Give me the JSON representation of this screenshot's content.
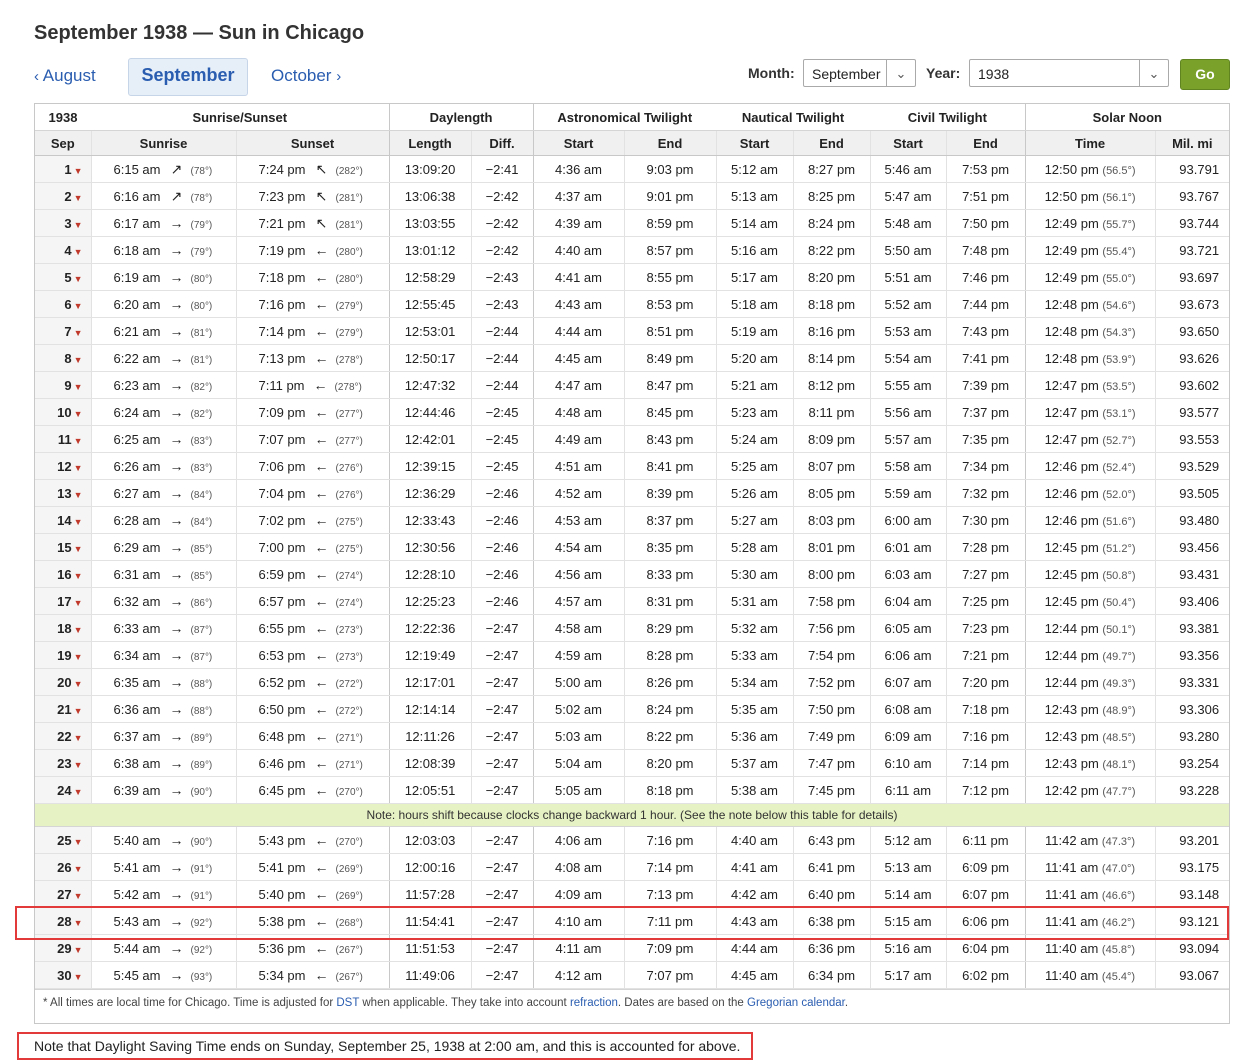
{
  "page": {
    "title": "September 1938 — Sun in Chicago"
  },
  "nav": {
    "prev": "August",
    "current": "September",
    "next": "October"
  },
  "controls": {
    "month_label": "Month:",
    "month_value": "September",
    "year_label": "Year:",
    "year_value": "1938",
    "go_label": "Go"
  },
  "table": {
    "group_headers": {
      "year": "1938",
      "sunrise_sunset": "Sunrise/Sunset",
      "daylength": "Daylength",
      "astro": "Astronomical Twilight",
      "nautical": "Nautical Twilight",
      "civil": "Civil Twilight",
      "noon": "Solar Noon"
    },
    "col_headers": {
      "day": "Sep",
      "sunrise": "Sunrise",
      "sunset": "Sunset",
      "length": "Length",
      "diff": "Diff.",
      "astro_start": "Start",
      "astro_end": "End",
      "naut_start": "Start",
      "naut_end": "End",
      "civil_start": "Start",
      "civil_end": "End",
      "noon_time": "Time",
      "distance": "Mil. mi"
    },
    "rows_before": [
      {
        "day": "1",
        "rise": "6:15 am",
        "rise_arrow": "↗",
        "rise_deg": "(78°)",
        "set": "7:24 pm",
        "set_arrow": "↖",
        "set_deg": "(282°)",
        "len": "13:09:20",
        "diff": "−2:41",
        "as": "4:36 am",
        "ae": "9:03 pm",
        "ns": "5:12 am",
        "ne": "8:27 pm",
        "cs": "5:46 am",
        "ce": "7:53 pm",
        "noon": "12:50 pm",
        "noon_deg": "(56.5°)",
        "mi": "93.791"
      },
      {
        "day": "2",
        "rise": "6:16 am",
        "rise_arrow": "↗",
        "rise_deg": "(78°)",
        "set": "7:23 pm",
        "set_arrow": "↖",
        "set_deg": "(281°)",
        "len": "13:06:38",
        "diff": "−2:42",
        "as": "4:37 am",
        "ae": "9:01 pm",
        "ns": "5:13 am",
        "ne": "8:25 pm",
        "cs": "5:47 am",
        "ce": "7:51 pm",
        "noon": "12:50 pm",
        "noon_deg": "(56.1°)",
        "mi": "93.767"
      },
      {
        "day": "3",
        "rise": "6:17 am",
        "rise_arrow": "→",
        "rise_deg": "(79°)",
        "set": "7:21 pm",
        "set_arrow": "↖",
        "set_deg": "(281°)",
        "len": "13:03:55",
        "diff": "−2:42",
        "as": "4:39 am",
        "ae": "8:59 pm",
        "ns": "5:14 am",
        "ne": "8:24 pm",
        "cs": "5:48 am",
        "ce": "7:50 pm",
        "noon": "12:49 pm",
        "noon_deg": "(55.7°)",
        "mi": "93.744"
      },
      {
        "day": "4",
        "rise": "6:18 am",
        "rise_arrow": "→",
        "rise_deg": "(79°)",
        "set": "7:19 pm",
        "set_arrow": "←",
        "set_deg": "(280°)",
        "len": "13:01:12",
        "diff": "−2:42",
        "as": "4:40 am",
        "ae": "8:57 pm",
        "ns": "5:16 am",
        "ne": "8:22 pm",
        "cs": "5:50 am",
        "ce": "7:48 pm",
        "noon": "12:49 pm",
        "noon_deg": "(55.4°)",
        "mi": "93.721"
      },
      {
        "day": "5",
        "rise": "6:19 am",
        "rise_arrow": "→",
        "rise_deg": "(80°)",
        "set": "7:18 pm",
        "set_arrow": "←",
        "set_deg": "(280°)",
        "len": "12:58:29",
        "diff": "−2:43",
        "as": "4:41 am",
        "ae": "8:55 pm",
        "ns": "5:17 am",
        "ne": "8:20 pm",
        "cs": "5:51 am",
        "ce": "7:46 pm",
        "noon": "12:49 pm",
        "noon_deg": "(55.0°)",
        "mi": "93.697"
      },
      {
        "day": "6",
        "rise": "6:20 am",
        "rise_arrow": "→",
        "rise_deg": "(80°)",
        "set": "7:16 pm",
        "set_arrow": "←",
        "set_deg": "(279°)",
        "len": "12:55:45",
        "diff": "−2:43",
        "as": "4:43 am",
        "ae": "8:53 pm",
        "ns": "5:18 am",
        "ne": "8:18 pm",
        "cs": "5:52 am",
        "ce": "7:44 pm",
        "noon": "12:48 pm",
        "noon_deg": "(54.6°)",
        "mi": "93.673"
      },
      {
        "day": "7",
        "rise": "6:21 am",
        "rise_arrow": "→",
        "rise_deg": "(81°)",
        "set": "7:14 pm",
        "set_arrow": "←",
        "set_deg": "(279°)",
        "len": "12:53:01",
        "diff": "−2:44",
        "as": "4:44 am",
        "ae": "8:51 pm",
        "ns": "5:19 am",
        "ne": "8:16 pm",
        "cs": "5:53 am",
        "ce": "7:43 pm",
        "noon": "12:48 pm",
        "noon_deg": "(54.3°)",
        "mi": "93.650"
      },
      {
        "day": "8",
        "rise": "6:22 am",
        "rise_arrow": "→",
        "rise_deg": "(81°)",
        "set": "7:13 pm",
        "set_arrow": "←",
        "set_deg": "(278°)",
        "len": "12:50:17",
        "diff": "−2:44",
        "as": "4:45 am",
        "ae": "8:49 pm",
        "ns": "5:20 am",
        "ne": "8:14 pm",
        "cs": "5:54 am",
        "ce": "7:41 pm",
        "noon": "12:48 pm",
        "noon_deg": "(53.9°)",
        "mi": "93.626"
      },
      {
        "day": "9",
        "rise": "6:23 am",
        "rise_arrow": "→",
        "rise_deg": "(82°)",
        "set": "7:11 pm",
        "set_arrow": "←",
        "set_deg": "(278°)",
        "len": "12:47:32",
        "diff": "−2:44",
        "as": "4:47 am",
        "ae": "8:47 pm",
        "ns": "5:21 am",
        "ne": "8:12 pm",
        "cs": "5:55 am",
        "ce": "7:39 pm",
        "noon": "12:47 pm",
        "noon_deg": "(53.5°)",
        "mi": "93.602"
      },
      {
        "day": "10",
        "rise": "6:24 am",
        "rise_arrow": "→",
        "rise_deg": "(82°)",
        "set": "7:09 pm",
        "set_arrow": "←",
        "set_deg": "(277°)",
        "len": "12:44:46",
        "diff": "−2:45",
        "as": "4:48 am",
        "ae": "8:45 pm",
        "ns": "5:23 am",
        "ne": "8:11 pm",
        "cs": "5:56 am",
        "ce": "7:37 pm",
        "noon": "12:47 pm",
        "noon_deg": "(53.1°)",
        "mi": "93.577"
      },
      {
        "day": "11",
        "rise": "6:25 am",
        "rise_arrow": "→",
        "rise_deg": "(83°)",
        "set": "7:07 pm",
        "set_arrow": "←",
        "set_deg": "(277°)",
        "len": "12:42:01",
        "diff": "−2:45",
        "as": "4:49 am",
        "ae": "8:43 pm",
        "ns": "5:24 am",
        "ne": "8:09 pm",
        "cs": "5:57 am",
        "ce": "7:35 pm",
        "noon": "12:47 pm",
        "noon_deg": "(52.7°)",
        "mi": "93.553"
      },
      {
        "day": "12",
        "rise": "6:26 am",
        "rise_arrow": "→",
        "rise_deg": "(83°)",
        "set": "7:06 pm",
        "set_arrow": "←",
        "set_deg": "(276°)",
        "len": "12:39:15",
        "diff": "−2:45",
        "as": "4:51 am",
        "ae": "8:41 pm",
        "ns": "5:25 am",
        "ne": "8:07 pm",
        "cs": "5:58 am",
        "ce": "7:34 pm",
        "noon": "12:46 pm",
        "noon_deg": "(52.4°)",
        "mi": "93.529"
      },
      {
        "day": "13",
        "rise": "6:27 am",
        "rise_arrow": "→",
        "rise_deg": "(84°)",
        "set": "7:04 pm",
        "set_arrow": "←",
        "set_deg": "(276°)",
        "len": "12:36:29",
        "diff": "−2:46",
        "as": "4:52 am",
        "ae": "8:39 pm",
        "ns": "5:26 am",
        "ne": "8:05 pm",
        "cs": "5:59 am",
        "ce": "7:32 pm",
        "noon": "12:46 pm",
        "noon_deg": "(52.0°)",
        "mi": "93.505"
      },
      {
        "day": "14",
        "rise": "6:28 am",
        "rise_arrow": "→",
        "rise_deg": "(84°)",
        "set": "7:02 pm",
        "set_arrow": "←",
        "set_deg": "(275°)",
        "len": "12:33:43",
        "diff": "−2:46",
        "as": "4:53 am",
        "ae": "8:37 pm",
        "ns": "5:27 am",
        "ne": "8:03 pm",
        "cs": "6:00 am",
        "ce": "7:30 pm",
        "noon": "12:46 pm",
        "noon_deg": "(51.6°)",
        "mi": "93.480"
      },
      {
        "day": "15",
        "rise": "6:29 am",
        "rise_arrow": "→",
        "rise_deg": "(85°)",
        "set": "7:00 pm",
        "set_arrow": "←",
        "set_deg": "(275°)",
        "len": "12:30:56",
        "diff": "−2:46",
        "as": "4:54 am",
        "ae": "8:35 pm",
        "ns": "5:28 am",
        "ne": "8:01 pm",
        "cs": "6:01 am",
        "ce": "7:28 pm",
        "noon": "12:45 pm",
        "noon_deg": "(51.2°)",
        "mi": "93.456"
      },
      {
        "day": "16",
        "rise": "6:31 am",
        "rise_arrow": "→",
        "rise_deg": "(85°)",
        "set": "6:59 pm",
        "set_arrow": "←",
        "set_deg": "(274°)",
        "len": "12:28:10",
        "diff": "−2:46",
        "as": "4:56 am",
        "ae": "8:33 pm",
        "ns": "5:30 am",
        "ne": "8:00 pm",
        "cs": "6:03 am",
        "ce": "7:27 pm",
        "noon": "12:45 pm",
        "noon_deg": "(50.8°)",
        "mi": "93.431"
      },
      {
        "day": "17",
        "rise": "6:32 am",
        "rise_arrow": "→",
        "rise_deg": "(86°)",
        "set": "6:57 pm",
        "set_arrow": "←",
        "set_deg": "(274°)",
        "len": "12:25:23",
        "diff": "−2:46",
        "as": "4:57 am",
        "ae": "8:31 pm",
        "ns": "5:31 am",
        "ne": "7:58 pm",
        "cs": "6:04 am",
        "ce": "7:25 pm",
        "noon": "12:45 pm",
        "noon_deg": "(50.4°)",
        "mi": "93.406"
      },
      {
        "day": "18",
        "rise": "6:33 am",
        "rise_arrow": "→",
        "rise_deg": "(87°)",
        "set": "6:55 pm",
        "set_arrow": "←",
        "set_deg": "(273°)",
        "len": "12:22:36",
        "diff": "−2:47",
        "as": "4:58 am",
        "ae": "8:29 pm",
        "ns": "5:32 am",
        "ne": "7:56 pm",
        "cs": "6:05 am",
        "ce": "7:23 pm",
        "noon": "12:44 pm",
        "noon_deg": "(50.1°)",
        "mi": "93.381"
      },
      {
        "day": "19",
        "rise": "6:34 am",
        "rise_arrow": "→",
        "rise_deg": "(87°)",
        "set": "6:53 pm",
        "set_arrow": "←",
        "set_deg": "(273°)",
        "len": "12:19:49",
        "diff": "−2:47",
        "as": "4:59 am",
        "ae": "8:28 pm",
        "ns": "5:33 am",
        "ne": "7:54 pm",
        "cs": "6:06 am",
        "ce": "7:21 pm",
        "noon": "12:44 pm",
        "noon_deg": "(49.7°)",
        "mi": "93.356"
      },
      {
        "day": "20",
        "rise": "6:35 am",
        "rise_arrow": "→",
        "rise_deg": "(88°)",
        "set": "6:52 pm",
        "set_arrow": "←",
        "set_deg": "(272°)",
        "len": "12:17:01",
        "diff": "−2:47",
        "as": "5:00 am",
        "ae": "8:26 pm",
        "ns": "5:34 am",
        "ne": "7:52 pm",
        "cs": "6:07 am",
        "ce": "7:20 pm",
        "noon": "12:44 pm",
        "noon_deg": "(49.3°)",
        "mi": "93.331"
      },
      {
        "day": "21",
        "rise": "6:36 am",
        "rise_arrow": "→",
        "rise_deg": "(88°)",
        "set": "6:50 pm",
        "set_arrow": "←",
        "set_deg": "(272°)",
        "len": "12:14:14",
        "diff": "−2:47",
        "as": "5:02 am",
        "ae": "8:24 pm",
        "ns": "5:35 am",
        "ne": "7:50 pm",
        "cs": "6:08 am",
        "ce": "7:18 pm",
        "noon": "12:43 pm",
        "noon_deg": "(48.9°)",
        "mi": "93.306"
      },
      {
        "day": "22",
        "rise": "6:37 am",
        "rise_arrow": "→",
        "rise_deg": "(89°)",
        "set": "6:48 pm",
        "set_arrow": "←",
        "set_deg": "(271°)",
        "len": "12:11:26",
        "diff": "−2:47",
        "as": "5:03 am",
        "ae": "8:22 pm",
        "ns": "5:36 am",
        "ne": "7:49 pm",
        "cs": "6:09 am",
        "ce": "7:16 pm",
        "noon": "12:43 pm",
        "noon_deg": "(48.5°)",
        "mi": "93.280"
      },
      {
        "day": "23",
        "rise": "6:38 am",
        "rise_arrow": "→",
        "rise_deg": "(89°)",
        "set": "6:46 pm",
        "set_arrow": "←",
        "set_deg": "(271°)",
        "len": "12:08:39",
        "diff": "−2:47",
        "as": "5:04 am",
        "ae": "8:20 pm",
        "ns": "5:37 am",
        "ne": "7:47 pm",
        "cs": "6:10 am",
        "ce": "7:14 pm",
        "noon": "12:43 pm",
        "noon_deg": "(48.1°)",
        "mi": "93.254"
      },
      {
        "day": "24",
        "rise": "6:39 am",
        "rise_arrow": "→",
        "rise_deg": "(90°)",
        "set": "6:45 pm",
        "set_arrow": "←",
        "set_deg": "(270°)",
        "len": "12:05:51",
        "diff": "−2:47",
        "as": "5:05 am",
        "ae": "8:18 pm",
        "ns": "5:38 am",
        "ne": "7:45 pm",
        "cs": "6:11 am",
        "ce": "7:12 pm",
        "noon": "12:42 pm",
        "noon_deg": "(47.7°)",
        "mi": "93.228"
      }
    ],
    "dst_note": "Note: hours shift because clocks change backward 1 hour. (See the note below this table for details)",
    "rows_after": [
      {
        "day": "25",
        "rise": "5:40 am",
        "rise_arrow": "→",
        "rise_deg": "(90°)",
        "set": "5:43 pm",
        "set_arrow": "←",
        "set_deg": "(270°)",
        "len": "12:03:03",
        "diff": "−2:47",
        "as": "4:06 am",
        "ae": "7:16 pm",
        "ns": "4:40 am",
        "ne": "6:43 pm",
        "cs": "5:12 am",
        "ce": "6:11 pm",
        "noon": "11:42 am",
        "noon_deg": "(47.3°)",
        "mi": "93.201"
      },
      {
        "day": "26",
        "rise": "5:41 am",
        "rise_arrow": "→",
        "rise_deg": "(91°)",
        "set": "5:41 pm",
        "set_arrow": "←",
        "set_deg": "(269°)",
        "len": "12:00:16",
        "diff": "−2:47",
        "as": "4:08 am",
        "ae": "7:14 pm",
        "ns": "4:41 am",
        "ne": "6:41 pm",
        "cs": "5:13 am",
        "ce": "6:09 pm",
        "noon": "11:41 am",
        "noon_deg": "(47.0°)",
        "mi": "93.175"
      },
      {
        "day": "27",
        "rise": "5:42 am",
        "rise_arrow": "→",
        "rise_deg": "(91°)",
        "set": "5:40 pm",
        "set_arrow": "←",
        "set_deg": "(269°)",
        "len": "11:57:28",
        "diff": "−2:47",
        "as": "4:09 am",
        "ae": "7:13 pm",
        "ns": "4:42 am",
        "ne": "6:40 pm",
        "cs": "5:14 am",
        "ce": "6:07 pm",
        "noon": "11:41 am",
        "noon_deg": "(46.6°)",
        "mi": "93.148"
      },
      {
        "day": "28",
        "rise": "5:43 am",
        "rise_arrow": "→",
        "rise_deg": "(92°)",
        "set": "5:38 pm",
        "set_arrow": "←",
        "set_deg": "(268°)",
        "len": "11:54:41",
        "diff": "−2:47",
        "as": "4:10 am",
        "ae": "7:11 pm",
        "ns": "4:43 am",
        "ne": "6:38 pm",
        "cs": "5:15 am",
        "ce": "6:06 pm",
        "noon": "11:41 am",
        "noon_deg": "(46.2°)",
        "mi": "93.121"
      },
      {
        "day": "29",
        "rise": "5:44 am",
        "rise_arrow": "→",
        "rise_deg": "(92°)",
        "set": "5:36 pm",
        "set_arrow": "←",
        "set_deg": "(267°)",
        "len": "11:51:53",
        "diff": "−2:47",
        "as": "4:11 am",
        "ae": "7:09 pm",
        "ns": "4:44 am",
        "ne": "6:36 pm",
        "cs": "5:16 am",
        "ce": "6:04 pm",
        "noon": "11:40 am",
        "noon_deg": "(45.8°)",
        "mi": "93.094"
      },
      {
        "day": "30",
        "rise": "5:45 am",
        "rise_arrow": "→",
        "rise_deg": "(93°)",
        "set": "5:34 pm",
        "set_arrow": "←",
        "set_deg": "(267°)",
        "len": "11:49:06",
        "diff": "−2:47",
        "as": "4:12 am",
        "ae": "7:07 pm",
        "ns": "4:45 am",
        "ne": "6:34 pm",
        "cs": "5:17 am",
        "ce": "6:02 pm",
        "noon": "11:40 am",
        "noon_deg": "(45.4°)",
        "mi": "93.067"
      }
    ],
    "footnote": {
      "text1": "* All times are local time for Chicago. Time is adjusted for ",
      "link_dst": "DST",
      "text2": " when applicable. They take into account ",
      "link_refraction": "refraction",
      "text3": ". Dates are based on the ",
      "link_gregorian": "Gregorian calendar",
      "text4": "."
    }
  },
  "bottom_note": "Note that Daylight Saving Time ends on Sunday, September 25, 1938 at 2:00 am, and this is accounted for above.",
  "colors": {
    "accent": "#2a5db0",
    "go_button": "#7aa22b",
    "highlight_border": "#e23a3a",
    "note_bg": "#e6f2c4",
    "dropdown_marker": "#c0392b"
  },
  "icons": {
    "prev": "chevron-left-icon",
    "next": "chevron-right-icon",
    "dropdown": "chevron-down-icon",
    "day_menu": "caret-down-icon"
  }
}
